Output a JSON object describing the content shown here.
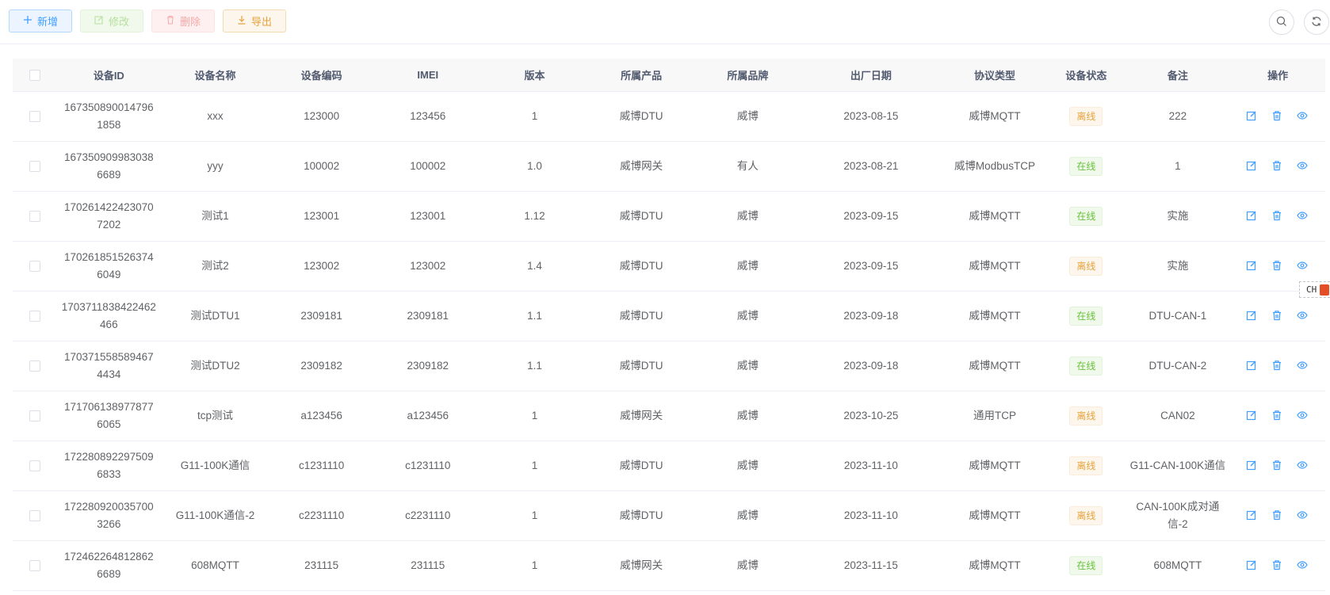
{
  "toolbar": {
    "add_label": "新增",
    "edit_label": "修改",
    "delete_label": "删除",
    "export_label": "导出"
  },
  "table": {
    "columns": [
      "设备ID",
      "设备名称",
      "设备编码",
      "IMEI",
      "版本",
      "所属产品",
      "所属品牌",
      "出厂日期",
      "协议类型",
      "设备状态",
      "备注",
      "操作"
    ],
    "rows": [
      {
        "id": "1673508900147961858",
        "name": "xxx",
        "code": "123000",
        "imei": "123456",
        "version": "1",
        "product": "威博DTU",
        "brand": "威博",
        "date": "2023-08-15",
        "protocol": "威博MQTT",
        "status": "离线",
        "remark": "222"
      },
      {
        "id": "1673509099830386689",
        "name": "yyy",
        "code": "100002",
        "imei": "100002",
        "version": "1.0",
        "product": "威博网关",
        "brand": "有人",
        "date": "2023-08-21",
        "protocol": "威博ModbusTCP",
        "status": "在线",
        "remark": "1"
      },
      {
        "id": "1702614224230707202",
        "name": "测试1",
        "code": "123001",
        "imei": "123001",
        "version": "1.12",
        "product": "威博DTU",
        "brand": "威博",
        "date": "2023-09-15",
        "protocol": "威博MQTT",
        "status": "在线",
        "remark": "实施"
      },
      {
        "id": "1702618515263746049",
        "name": "测试2",
        "code": "123002",
        "imei": "123002",
        "version": "1.4",
        "product": "威博DTU",
        "brand": "威博",
        "date": "2023-09-15",
        "protocol": "威博MQTT",
        "status": "离线",
        "remark": "实施"
      },
      {
        "id": "1703711838422462466",
        "name": "测试DTU1",
        "code": "2309181",
        "imei": "2309181",
        "version": "1.1",
        "product": "威博DTU",
        "brand": "威博",
        "date": "2023-09-18",
        "protocol": "威博MQTT",
        "status": "在线",
        "remark": "DTU-CAN-1"
      },
      {
        "id": "1703715585894674434",
        "name": "测试DTU2",
        "code": "2309182",
        "imei": "2309182",
        "version": "1.1",
        "product": "威博DTU",
        "brand": "威博",
        "date": "2023-09-18",
        "protocol": "威博MQTT",
        "status": "在线",
        "remark": "DTU-CAN-2"
      },
      {
        "id": "1717061389778776065",
        "name": "tcp测试",
        "code": "a123456",
        "imei": "a123456",
        "version": "1",
        "product": "威博网关",
        "brand": "威博",
        "date": "2023-10-25",
        "protocol": "通用TCP",
        "status": "离线",
        "remark": "CAN02"
      },
      {
        "id": "1722808922975096833",
        "name": "G11-100K通信",
        "code": "c1231110",
        "imei": "c1231110",
        "version": "1",
        "product": "威博DTU",
        "brand": "威博",
        "date": "2023-11-10",
        "protocol": "威博MQTT",
        "status": "离线",
        "remark": "G11-CAN-100K通信"
      },
      {
        "id": "1722809200357003266",
        "name": "G11-100K通信-2",
        "code": "c2231110",
        "imei": "c2231110",
        "version": "1",
        "product": "威博DTU",
        "brand": "威博",
        "date": "2023-11-10",
        "protocol": "威博MQTT",
        "status": "离线",
        "remark": "CAN-100K成对通信-2"
      },
      {
        "id": "1724622648128626689",
        "name": "608MQTT",
        "code": "231115",
        "imei": "231115",
        "version": "1",
        "product": "威博网关",
        "brand": "威博",
        "date": "2023-11-15",
        "protocol": "威博MQTT",
        "status": "在线",
        "remark": "608MQTT"
      }
    ]
  },
  "lang_badge": "CH"
}
